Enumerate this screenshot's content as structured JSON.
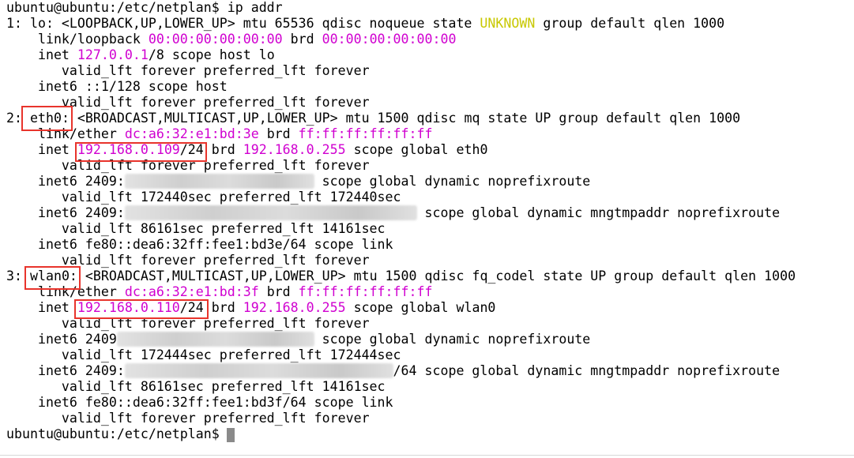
{
  "lines": [
    [
      {
        "t": "ubuntu@ubuntu:/etc/netplan$ ip addr"
      }
    ],
    [
      {
        "t": "1: lo: <LOOPBACK,UP,LOWER_UP> mtu 65536 qdisc noqueue state "
      },
      {
        "t": "UNKNOWN",
        "c": "yel"
      },
      {
        "t": " group default qlen 1000"
      }
    ],
    [
      {
        "t": "    link/loopback "
      },
      {
        "t": "00:00:00:00:00:00",
        "c": "mag"
      },
      {
        "t": " brd "
      },
      {
        "t": "00:00:00:00:00:00",
        "c": "mag"
      }
    ],
    [
      {
        "t": "    inet "
      },
      {
        "t": "127.0.0.1",
        "c": "mag"
      },
      {
        "t": "/8 scope host lo"
      }
    ],
    [
      {
        "t": "       valid_lft forever preferred_lft forever"
      }
    ],
    [
      {
        "t": "    inet6 ::1/128 scope host"
      }
    ],
    [
      {
        "t": "       valid_lft forever preferred_lft forever"
      }
    ],
    [
      {
        "t": "2: "
      },
      {
        "t": "eth0:"
      },
      {
        "t": " <BROADCAST,MULTICAST,UP,LOWER_UP> mtu 1500 qdisc mq state UP group default qlen 1000"
      }
    ],
    [
      {
        "t": "    link/ether "
      },
      {
        "t": "dc:a6:32:e1:bd:3e",
        "c": "mag"
      },
      {
        "t": " brd "
      },
      {
        "t": "ff:ff:ff:ff:ff:ff",
        "c": "mag"
      }
    ],
    [
      {
        "t": "    inet "
      },
      {
        "t": "192.168.0.109",
        "c": "mag"
      },
      {
        "t": "/24 brd "
      },
      {
        "t": "192.168.0.255",
        "c": "mag"
      },
      {
        "t": " scope global eth0"
      }
    ],
    [
      {
        "t": "       valid_lft forever preferred_lft forever"
      }
    ],
    [
      {
        "t": "    inet6 2409:"
      },
      {
        "t": "xxxxxxxxxxxxxxxxxxxxxxxx",
        "c": "blur"
      },
      {
        "t": " scope global dynamic noprefixroute"
      }
    ],
    [
      {
        "t": "       valid_lft 172440sec preferred_lft 172440sec"
      }
    ],
    [
      {
        "t": "    inet6 2409:"
      },
      {
        "t": "xxxxxxxxxxxxxxxxxxxxxxxxxxxxxxxxxxxxx",
        "c": "blur"
      },
      {
        "t": " scope global dynamic mngtmpaddr noprefixroute"
      }
    ],
    [
      {
        "t": "       valid_lft 86161sec preferred_lft 14161sec"
      }
    ],
    [
      {
        "t": "    inet6 fe80::dea6:32ff:fee1:bd3e/64 scope link"
      }
    ],
    [
      {
        "t": "       valid_lft forever preferred_lft forever"
      }
    ],
    [
      {
        "t": "3: "
      },
      {
        "t": "wlan0:"
      },
      {
        "t": " <BROADCAST,MULTICAST,UP,LOWER_UP> mtu 1500 qdisc fq_codel state UP group default qlen 1000"
      }
    ],
    [
      {
        "t": "    link/ether "
      },
      {
        "t": "dc:a6:32:e1:bd:3f",
        "c": "mag"
      },
      {
        "t": " brd "
      },
      {
        "t": "ff:ff:ff:ff:ff:ff",
        "c": "mag"
      }
    ],
    [
      {
        "t": "    inet "
      },
      {
        "t": "192.168.0.110",
        "c": "mag"
      },
      {
        "t": "/24 brd "
      },
      {
        "t": "192.168.0.255",
        "c": "mag"
      },
      {
        "t": " scope global wlan0"
      }
    ],
    [
      {
        "t": "       valid_lft forever preferred_lft forever"
      }
    ],
    [
      {
        "t": "    inet6 2409"
      },
      {
        "t": "xxxxxxxxxxxxxxxxxxxxxxxxx",
        "c": "blur"
      },
      {
        "t": " scope global dynamic noprefixroute"
      }
    ],
    [
      {
        "t": "       valid_lft 172444sec preferred_lft 172444sec"
      }
    ],
    [
      {
        "t": "    inet6 2409:"
      },
      {
        "t": "xxxxxxxxxxxxxxxxxxxxxxxxxxxxxxxxxx",
        "c": "blur"
      },
      {
        "t": "/64 scope global dynamic mngtmpaddr noprefixroute"
      }
    ],
    [
      {
        "t": "       valid_lft 86161sec preferred_lft 14161sec"
      }
    ],
    [
      {
        "t": "    inet6 fe80::dea6:32ff:fee1:bd3f/64 scope link"
      }
    ],
    [
      {
        "t": "       valid_lft forever preferred_lft forever"
      }
    ],
    [
      {
        "t": "ubuntu@ubuntu:/etc/netplan$ "
      }
    ]
  ],
  "colors": {
    "text": "#000000",
    "magenta": "#d000d0",
    "yellow": "#c8c800",
    "highlight": "#e8342c",
    "background": "#ffffff"
  }
}
